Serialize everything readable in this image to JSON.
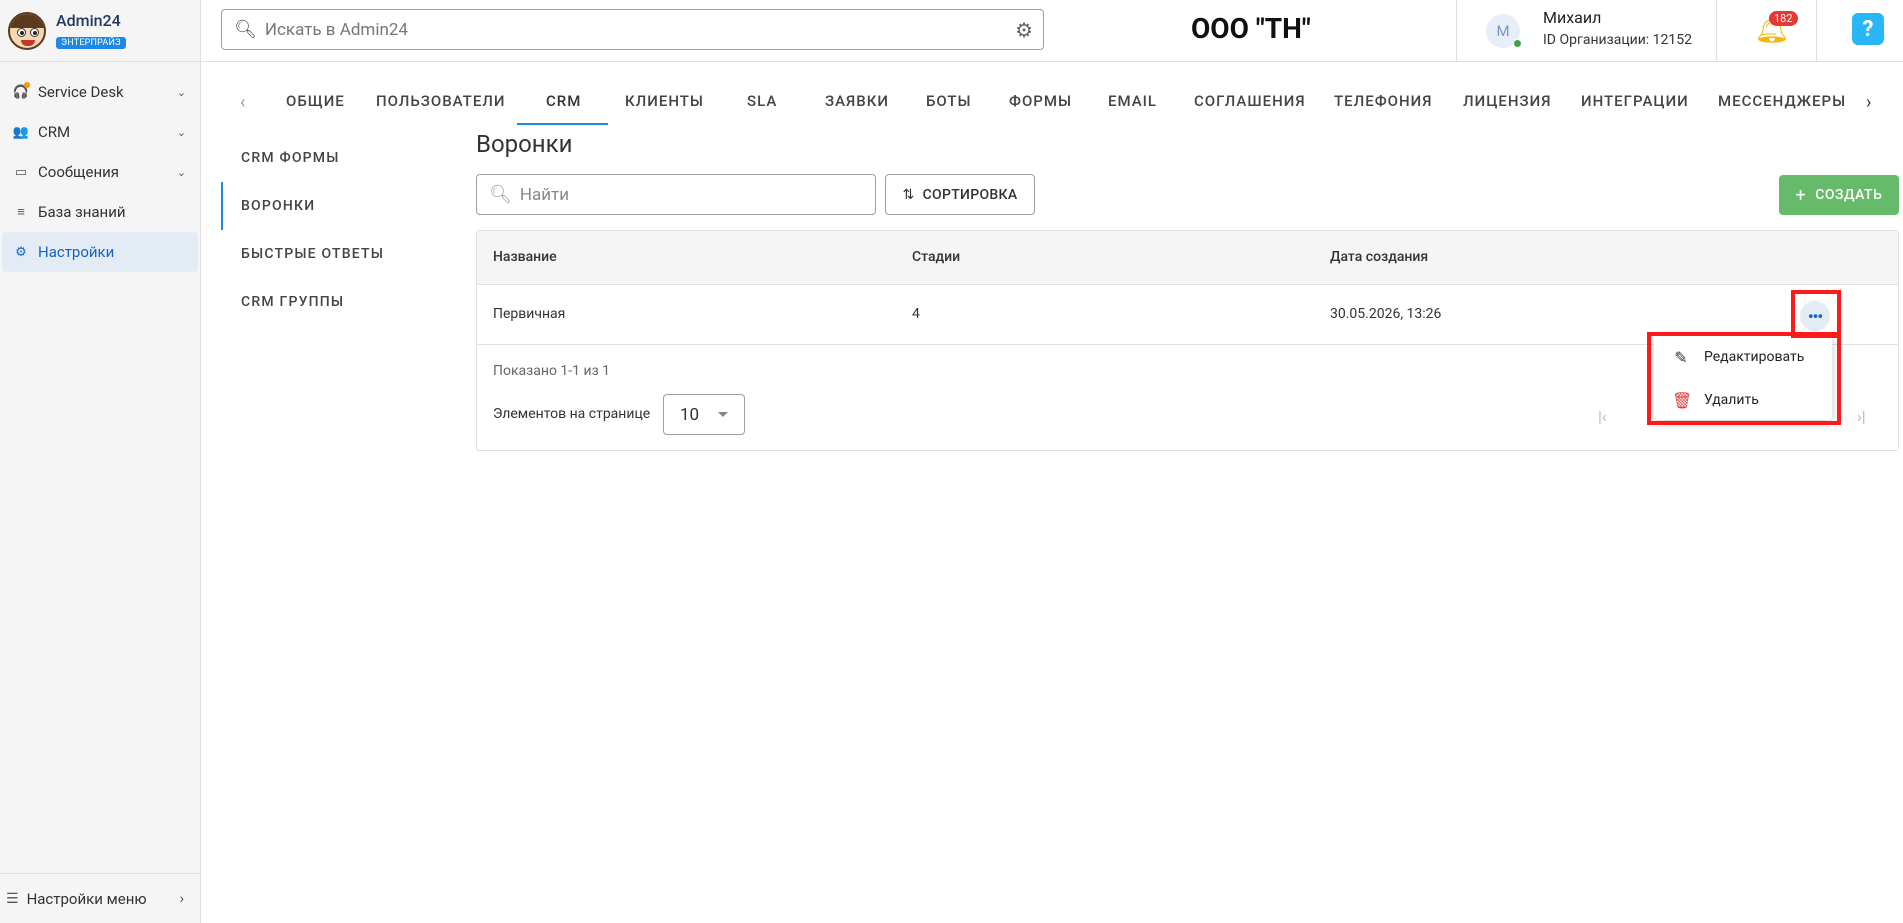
{
  "brand": {
    "name": "Admin24",
    "badge": "ЭНТЕРПРАЙЗ"
  },
  "sidebar": {
    "items": [
      {
        "label": "Service Desk",
        "icon": "headset-icon",
        "expandable": true
      },
      {
        "label": "CRM",
        "icon": "people-icon",
        "expandable": true
      },
      {
        "label": "Сообщения",
        "icon": "chat-icon",
        "expandable": true
      },
      {
        "label": "База знаний",
        "icon": "database-icon",
        "expandable": false
      },
      {
        "label": "Настройки",
        "icon": "gear-icon",
        "expandable": false,
        "active": true
      }
    ],
    "footer_label": "Настройки меню"
  },
  "header": {
    "search_placeholder": "Искать в Admin24",
    "org_title": "ООО \"ТН\"",
    "user_initial": "М",
    "user_name": "Михаил",
    "org_id": "ID Организации: 12152",
    "notifications_count": "182",
    "help_label": "?"
  },
  "tabs": [
    "ОБЩИЕ",
    "ПОЛЬЗОВАТЕЛИ",
    "CRM",
    "КЛИЕНТЫ",
    "SLA",
    "ЗАЯВКИ",
    "БОТЫ",
    "ФОРМЫ",
    "EMAIL",
    "СОГЛАШЕНИЯ",
    "ТЕЛЕФОНИЯ",
    "ЛИЦЕНЗИЯ",
    "ИНТЕГРАЦИИ",
    "МЕССЕНДЖЕРЫ"
  ],
  "active_tab": "CRM",
  "subnav": [
    "CRM ФОРМЫ",
    "ВОРОНКИ",
    "БЫСТРЫЕ ОТВЕТЫ",
    "CRM ГРУППЫ"
  ],
  "active_subnav": "ВОРОНКИ",
  "main": {
    "title": "Воронки",
    "search_placeholder": "Найти",
    "sort_label": "СОРТИРОВКА",
    "create_label": "СОЗДАТЬ"
  },
  "table": {
    "columns": [
      "Название",
      "Стадии",
      "Дата создания"
    ],
    "rows": [
      {
        "name": "Первичная",
        "stages": "4",
        "created": "30.05.2026, 13:26"
      }
    ],
    "shown_text": "Показано 1-1 из 1",
    "per_page_label": "Элементов на странице",
    "per_page_value": "10"
  },
  "row_menu": {
    "edit_label": "Редактировать",
    "delete_label": "Удалить"
  },
  "colors": {
    "accent": "#1e88e5",
    "create": "#66bb6a",
    "highlight": "#ff1a1a",
    "danger": "#e53935"
  }
}
